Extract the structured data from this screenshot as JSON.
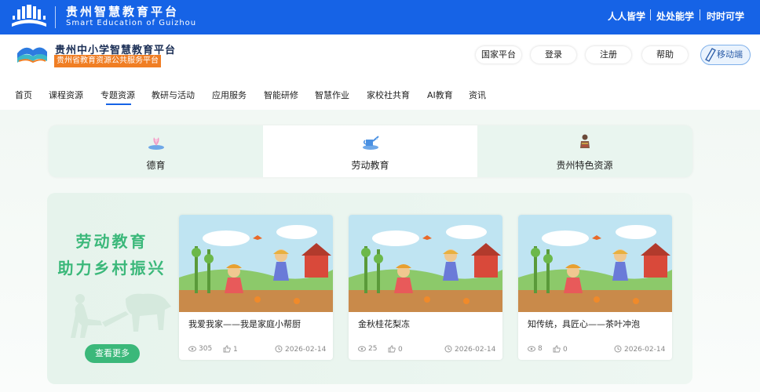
{
  "topbar": {
    "title_cn": "贵州智慧教育平台",
    "title_en": "Smart Education of Guizhou",
    "slogans": [
      "人人皆学",
      "处处能学",
      "时时可学"
    ]
  },
  "header": {
    "name": "贵州中小学智慧教育平台",
    "subname": "贵州省教育资源公共服务平台",
    "buttons": [
      "国家平台",
      "登录",
      "注册",
      "帮助"
    ],
    "mobile": "移动端"
  },
  "nav": {
    "items": [
      "首页",
      "课程资源",
      "专题资源",
      "教研与活动",
      "应用服务",
      "智能研修",
      "智慧作业",
      "家校社共育",
      "AI教育",
      "资讯"
    ],
    "active": "专题资源"
  },
  "tabs": [
    {
      "label": "德育",
      "icon": "flower-icon"
    },
    {
      "label": "劳动教育",
      "icon": "watering-can-icon"
    },
    {
      "label": "贵州特色资源",
      "icon": "figure-icon"
    }
  ],
  "banner": {
    "line1": "劳动教育",
    "line2": "助力乡村振兴",
    "more_button": "查看更多"
  },
  "cards": [
    {
      "title": "我爱我家——我是家庭小帮厨",
      "views": "305",
      "likes": "1",
      "date": "2026-02-14"
    },
    {
      "title": "金秋桂花梨冻",
      "views": "25",
      "likes": "0",
      "date": "2026-02-14"
    },
    {
      "title": "知传统，具匠心——茶叶冲泡",
      "views": "8",
      "likes": "0",
      "date": "2026-02-14"
    }
  ],
  "colors": {
    "topbar": "#1663e6",
    "accent_green": "#3bb87a",
    "orange_tag": "#f07e24"
  }
}
